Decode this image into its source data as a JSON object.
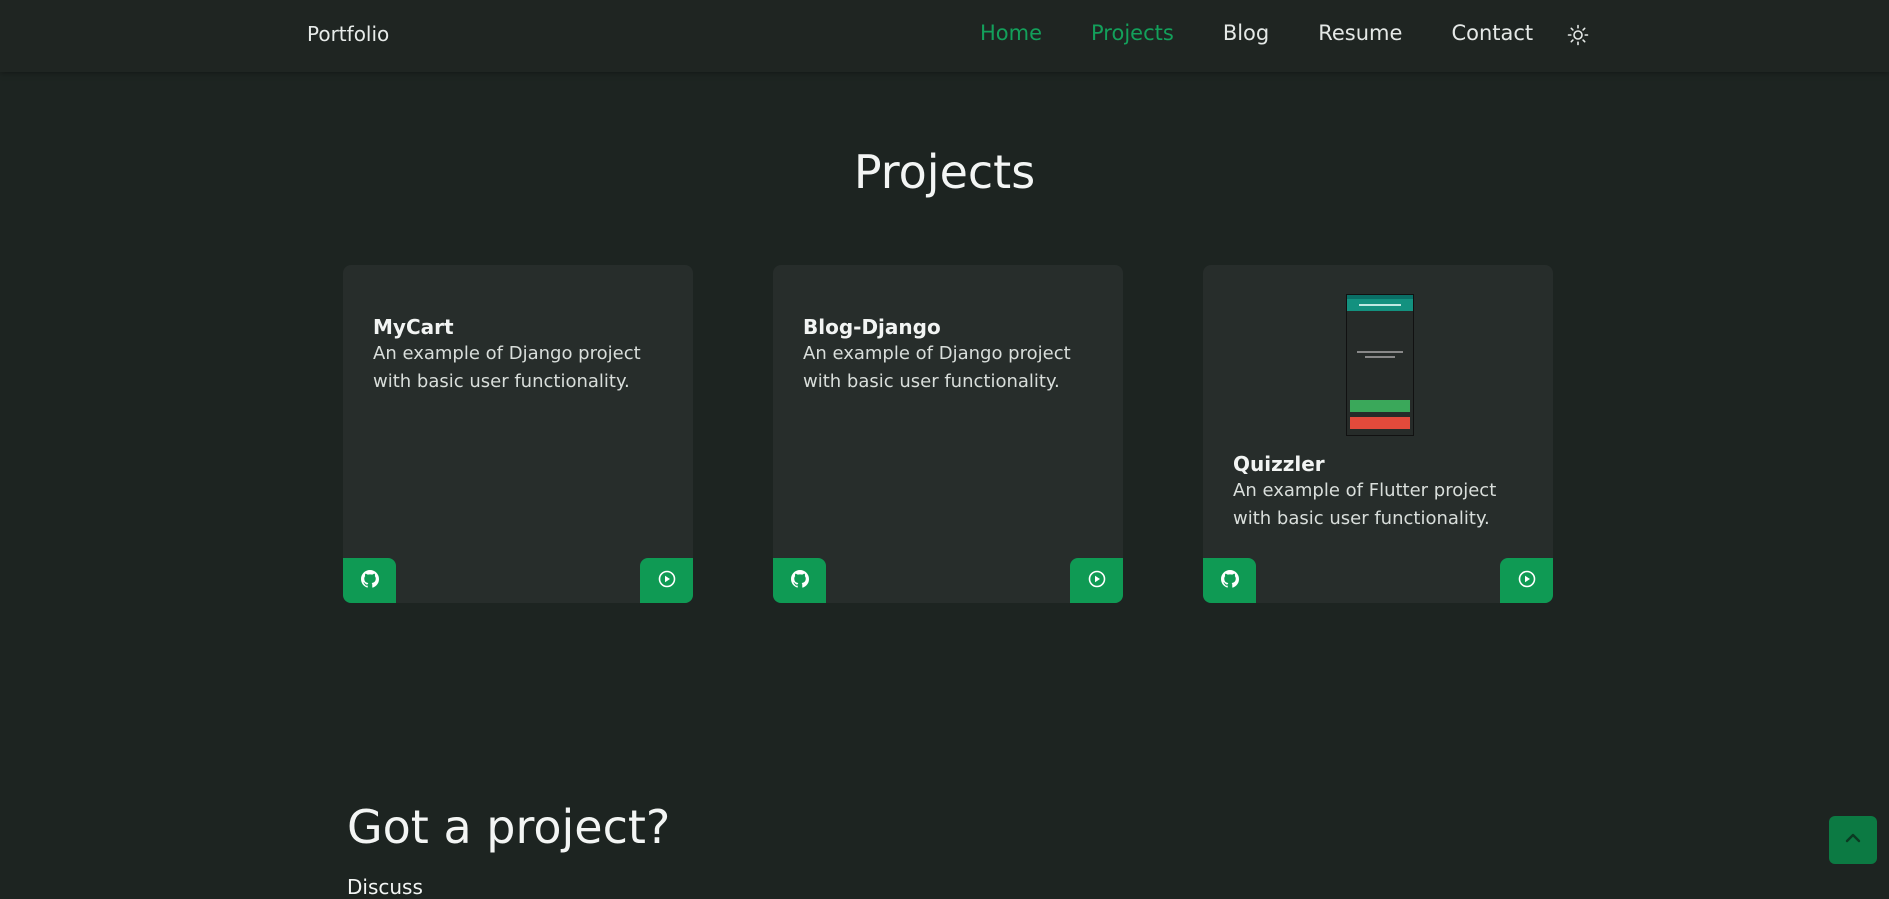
{
  "navbar": {
    "brand": "Portfolio",
    "links": [
      "Home",
      "Projects",
      "Blog",
      "Resume",
      "Contact"
    ],
    "theme_icon": "sun-icon"
  },
  "main": {
    "heading": "Projects",
    "projects": [
      {
        "title": "MyCart",
        "description": "An example of Django project with basic user functionality.",
        "github_icon": "github-icon",
        "demo_icon": "play-circle-icon"
      },
      {
        "title": "Blog-Django",
        "description": "An example of Django project with basic user functionality.",
        "github_icon": "github-icon",
        "demo_icon": "play-circle-icon"
      },
      {
        "title": "Quizzler",
        "description": "An example of Flutter project with basic user functionality.",
        "github_icon": "github-icon",
        "demo_icon": "play-circle-icon"
      }
    ]
  },
  "cta": {
    "heading": "Got a project?",
    "subheading": "Discuss"
  },
  "colors": {
    "accent": "#13a05b",
    "button": "#0f9a54",
    "background": "#1d2421",
    "card": "#272d2b"
  },
  "scroll_top_icon": "chevron-up-icon"
}
